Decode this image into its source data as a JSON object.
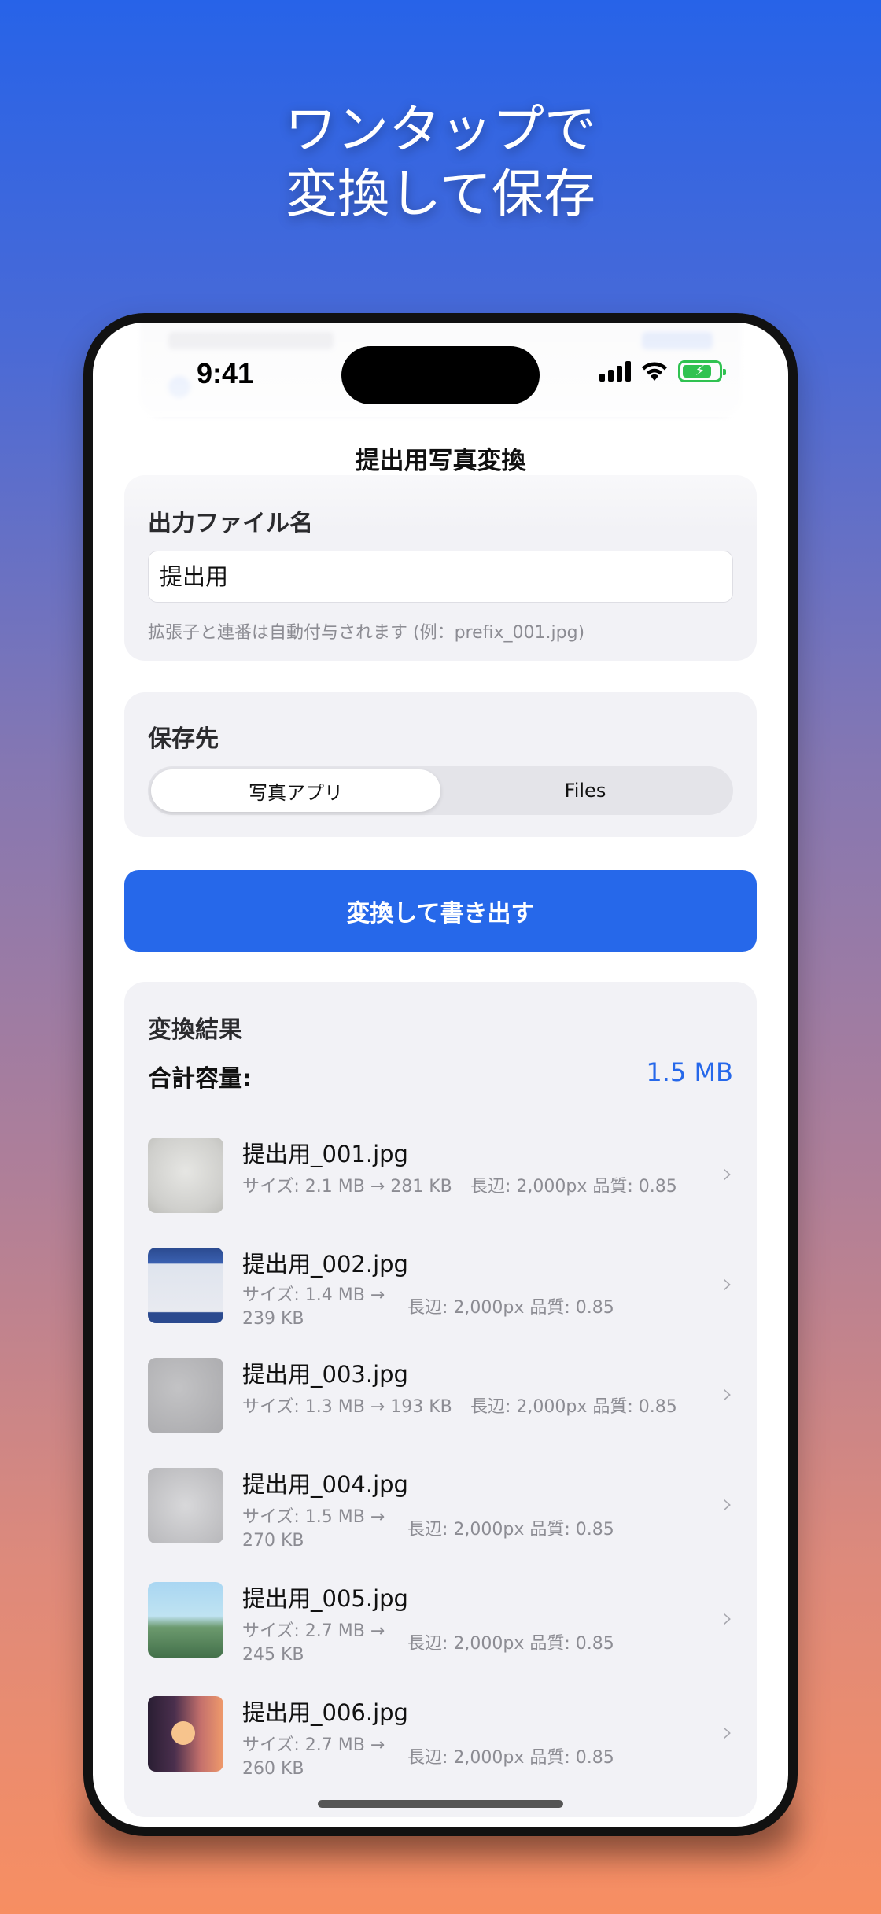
{
  "headline": {
    "line1": "ワンタップで",
    "line2": "変換して保存"
  },
  "status_bar": {
    "time": "9:41",
    "icons": [
      "signal-icon",
      "wifi-icon",
      "battery-charging-icon"
    ]
  },
  "nav": {
    "title": "提出用写真変換"
  },
  "filename_section": {
    "label": "出力ファイル名",
    "value": "提出用",
    "hint": "拡張子と連番は自動付与されます (例：prefix_001.jpg)"
  },
  "destination_section": {
    "label": "保存先",
    "options": [
      "写真アプリ",
      "Files"
    ],
    "selected": "写真アプリ"
  },
  "convert_button": {
    "label": "変換して書き出す"
  },
  "results": {
    "label": "変換結果",
    "total_label": "合計容量:",
    "total_value": "1.5 MB",
    "items": [
      {
        "name": "提出用_001.jpg",
        "size": "サイズ: 2.1 MB → 281 KB",
        "size_line2": "",
        "extra": "長辺: 2,000px  品質: 0.85"
      },
      {
        "name": "提出用_002.jpg",
        "size": "サイズ: 1.4 MB →",
        "size_line2": "239 KB",
        "extra": "長辺: 2,000px  品質: 0.85"
      },
      {
        "name": "提出用_003.jpg",
        "size": "サイズ: 1.3 MB → 193 KB",
        "size_line2": "",
        "extra": "長辺: 2,000px  品質: 0.85"
      },
      {
        "name": "提出用_004.jpg",
        "size": "サイズ: 1.5 MB →",
        "size_line2": "270 KB",
        "extra": "長辺: 2,000px  品質: 0.85"
      },
      {
        "name": "提出用_005.jpg",
        "size": "サイズ: 2.7 MB →",
        "size_line2": "245 KB",
        "extra": "長辺: 2,000px  品質: 0.85"
      },
      {
        "name": "提出用_006.jpg",
        "size": "サイズ: 2.7 MB →",
        "size_line2": "260 KB",
        "extra": "長辺: 2,000px  品質: 0.85"
      }
    ]
  },
  "colors": {
    "accent": "#2668ea",
    "card": "#f2f2f6",
    "battery": "#30c251"
  }
}
